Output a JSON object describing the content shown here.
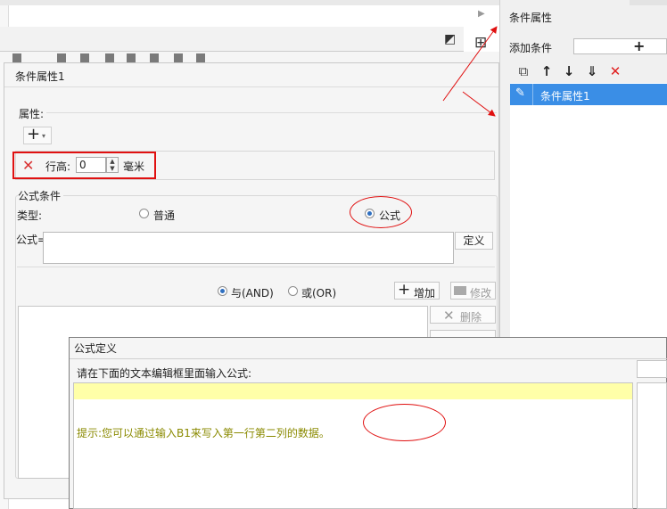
{
  "right_panel": {
    "title": "条件属性",
    "add_condition_label": "添加条件",
    "add_plus": "+",
    "toolbar_icons": [
      "copy-icon",
      "arrow-up-icon",
      "arrow-down-icon",
      "move-bottom-icon",
      "delete-icon"
    ],
    "toolbar_glyphs": [
      "⧉",
      "↑",
      "↓",
      "⇓",
      "✕"
    ],
    "items": [
      {
        "label": "条件属性1",
        "icon": "edit-icon",
        "glyph": "✎",
        "selected": true
      }
    ]
  },
  "dialog1": {
    "title": "条件属性1",
    "property_section_label": "属性:",
    "add_button_glyph": "+",
    "add_button_caret": "▾",
    "row_height": {
      "delete_glyph": "✕",
      "label": "行高:",
      "value": "0",
      "unit": "毫米"
    },
    "formula_condition_label": "公式条件",
    "type_label": "类型:",
    "type_options": [
      {
        "label": "普通",
        "selected": false
      },
      {
        "label": "公式",
        "selected": true
      }
    ],
    "formula_label": "公式=",
    "formula_value": "",
    "define_button": "定义",
    "logic_options": [
      {
        "label": "与(AND)",
        "selected": true
      },
      {
        "label": "或(OR)",
        "selected": false
      }
    ],
    "add_button": "增加",
    "modify_button": "修改",
    "delete_button": "删除"
  },
  "dialog2": {
    "title": "公式定义",
    "prompt": "请在下面的文本编辑框里面输入公式:",
    "editor_value": "",
    "hint": "提示:您可以通过输入B1来写入第一行第二列的数据。"
  },
  "colors": {
    "annotation_red": "#e01010",
    "selection_blue": "#3a8ee6",
    "editor_highlight": "#ffffa8",
    "hint_text": "#8a8a00"
  }
}
